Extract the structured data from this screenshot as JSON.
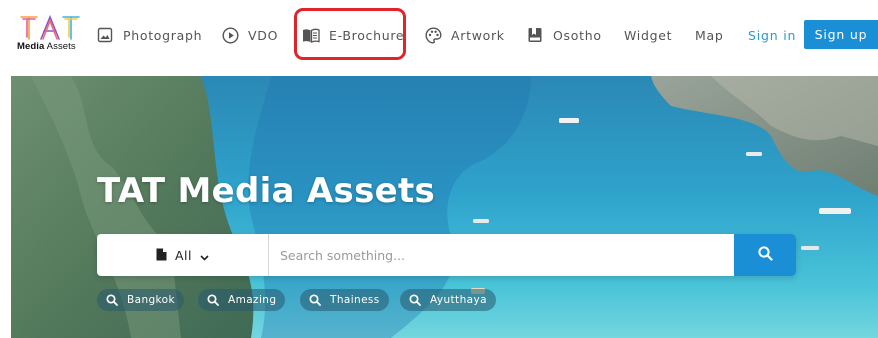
{
  "logo": {
    "mark_text": "TAT",
    "text_bold": "Media",
    "text_regular": " Assets"
  },
  "nav": {
    "items": [
      {
        "label": "Photograph",
        "icon": "image-icon"
      },
      {
        "label": "VDO",
        "icon": "play-circle-icon"
      },
      {
        "label": "E-Brochure",
        "icon": "book-open-icon",
        "highlighted": true
      },
      {
        "label": "Artwork",
        "icon": "palette-icon"
      },
      {
        "label": "Osotho",
        "icon": "bookmark-square-icon"
      },
      {
        "label": "Widget",
        "icon": ""
      },
      {
        "label": "Map",
        "icon": ""
      }
    ],
    "sign_in": "Sign in",
    "sign_up": "Sign up"
  },
  "hero": {
    "title": "TAT Media Assets"
  },
  "search": {
    "category_label": "All",
    "category_icon": "document-icon",
    "placeholder": "Search something...",
    "button_icon": "search-icon"
  },
  "tags": [
    {
      "label": "Bangkok"
    },
    {
      "label": "Amazing"
    },
    {
      "label": "Thainess"
    },
    {
      "label": "Ayutthaya"
    }
  ],
  "colors": {
    "accent": "#1a8fd6",
    "highlight": "#e2242a",
    "sign_in_text": "#2a9ad6"
  }
}
